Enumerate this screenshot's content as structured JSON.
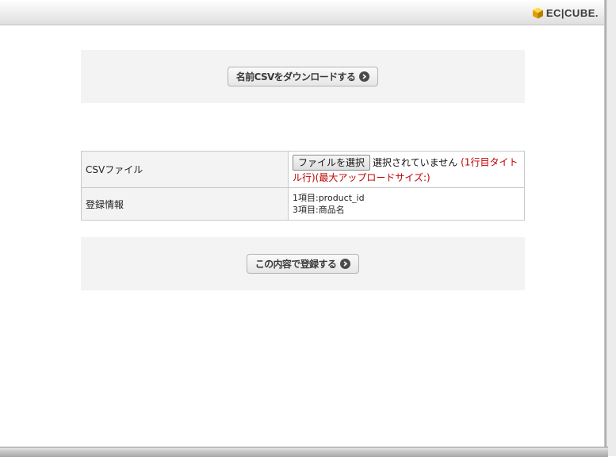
{
  "header": {
    "logo_text": "EC|CUBE."
  },
  "download_panel": {
    "button_label": "名前CSVをダウンロードする"
  },
  "form": {
    "rows": [
      {
        "label": "CSVファイル",
        "file_button_label": "ファイルを選択",
        "file_status": "選択されていません",
        "note": "(1行目タイトル行)(最大アップロードサイズ:)"
      },
      {
        "label": "登録情報",
        "lines": [
          "1項目:product_id",
          "3項目:商品名"
        ]
      }
    ]
  },
  "submit_panel": {
    "button_label": "この内容で登録する"
  },
  "colors": {
    "note": "#c00000",
    "panel_bg": "#f3f3f3",
    "logo_cube": "#f0b400"
  },
  "icons": {
    "logo": "cube-icon",
    "button_arrow": "arrow-right-circle-icon"
  }
}
